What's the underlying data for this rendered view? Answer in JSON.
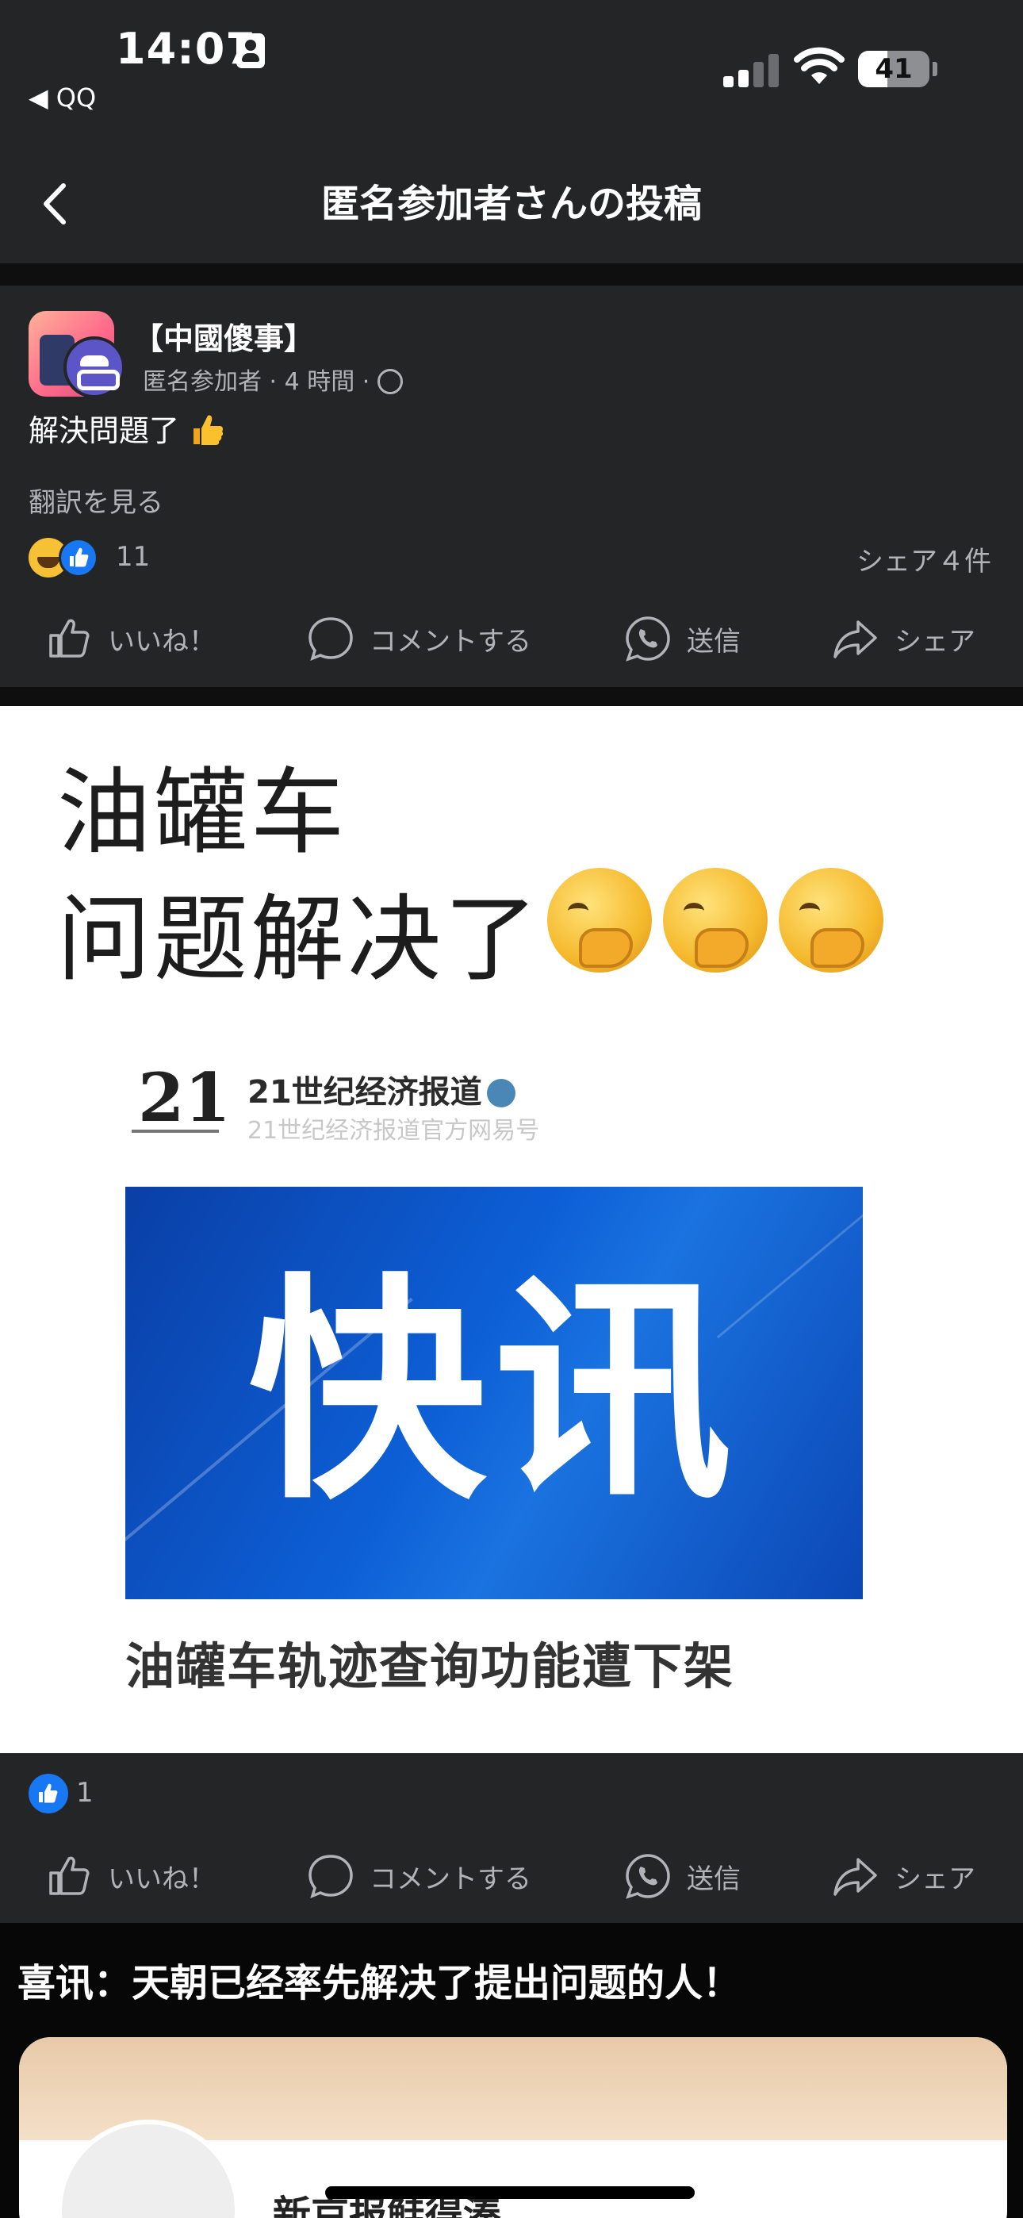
{
  "status_bar": {
    "time": "14:07",
    "back_app": "◀ QQ",
    "battery": "41",
    "battery_level": 0.41
  },
  "header": {
    "title": "匿名参加者さんの投稿"
  },
  "post": {
    "group_name": "【中國傻事】",
    "author": "匿名参加者",
    "time": "4 時間",
    "text": "解決問題了",
    "translate": "翻訳を見る",
    "reaction_count": "11",
    "shares": "シェア４件"
  },
  "actions": {
    "like": "いいね！",
    "comment": "コメントする",
    "send": "送信",
    "share": "シェア"
  },
  "shared_image": {
    "line1": "油罐车",
    "line2": "问题解决了",
    "news_logo": "21",
    "news_name": "21世纪经济报道",
    "news_sub": "21世纪经济报道官方网易号",
    "banner": "快讯",
    "caption": "油罐车轨迹查询功能遭下架"
  },
  "image_reactions": {
    "count": "1"
  },
  "next_post": {
    "title": "喜讯：天朝已经率先解决了提出问题的人！",
    "name": "新京报鲑得湊"
  },
  "colors": {
    "background": "#242527",
    "accent_blue": "#1877f2",
    "banner_blue": "#0d5fd6"
  }
}
